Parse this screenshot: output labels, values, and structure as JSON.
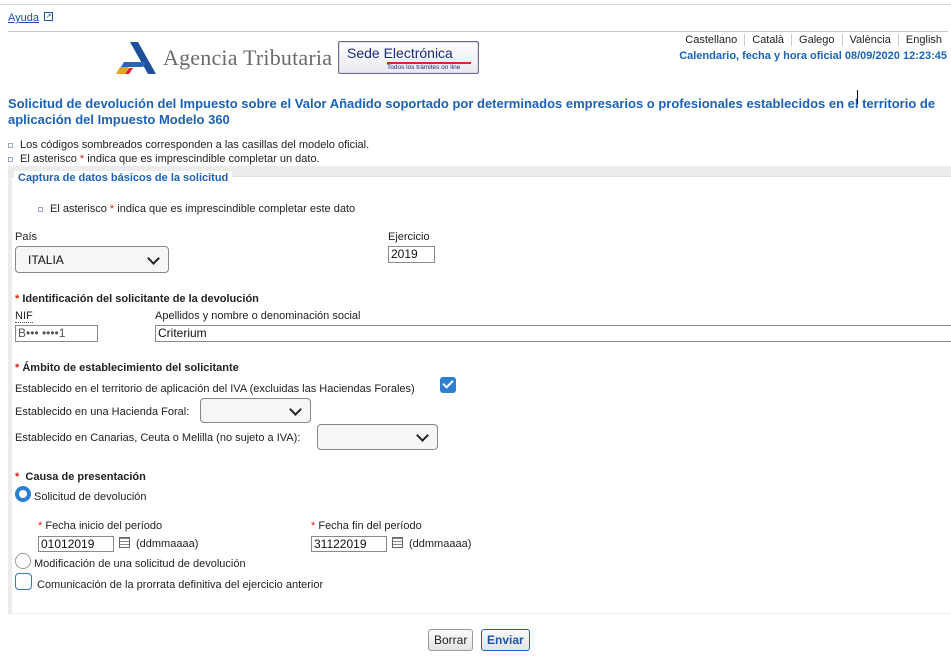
{
  "header": {
    "help_link": "Ayuda",
    "logo_text": "Agencia Tributaria",
    "sede_main": "Sede Electrónica",
    "sede_sub": "Todos los trámites on line",
    "languages": [
      "Castellano",
      "Català",
      "Galego",
      "València",
      "English"
    ],
    "calendar": "Calendario, fecha y hora oficial 08/09/2020 12:23:45"
  },
  "page": {
    "title": "Solicitud de devolución del Impuesto sobre el Valor Añadido soportado por determinados empresarios o profesionales establecidos en el territorio de aplicación del Impuesto Modelo 360",
    "note1": "Los códigos sombreados corresponden a las casillas del modelo oficial.",
    "note2_pre": "El asterisco ",
    "note2_star": "*",
    "note2_post": " indica que es imprescindible completar un dato."
  },
  "form": {
    "legend": "Captura de datos básicos de la solicitud",
    "asterisk_note_pre": "El asterisco ",
    "asterisk_note_star": "*",
    "asterisk_note_post": " indica que es imprescindible completar este dato",
    "pais_label": "País",
    "pais_value": "ITALIA",
    "ejercicio_label": "Ejercicio",
    "ejercicio_value": "2019",
    "ident_title": "Identificación del solicitante de la devolución",
    "nif_label": "NIF",
    "nif_value": "B••• ••••1",
    "nombre_label": "Apellidos y nombre o denominación social",
    "nombre_value": "Criterium",
    "ambito_title": "Ámbito de establecimiento del solicitante",
    "ambito_iva": "Establecido en el territorio de aplicación del IVA (excluidas las Haciendas Forales)",
    "ambito_foral": "Establecido en una Hacienda Foral:",
    "ambito_canarias": "Establecido en Canarias, Ceuta o Melilla (no sujeto a IVA):",
    "causa_title": "Causa de presentación",
    "opt_solicitud": "Solicitud de devolución",
    "fecha_inicio_label": "Fecha inicio del período",
    "fecha_inicio_value": "01012019",
    "fecha_fin_label": "Fecha fin del período",
    "fecha_fin_value": "31122019",
    "date_format": "(ddmmaaaa)",
    "opt_modificacion": "Modificación de una solicitud de devolución",
    "opt_prorrata": "Comunicación de la prorrata definitiva del ejercicio anterior",
    "star": "*"
  },
  "buttons": {
    "borrar": "Borrar",
    "enviar": "Enviar"
  },
  "colors": {
    "accent": "#1a63b8",
    "required": "#d21111",
    "panel_bg": "#ececec"
  }
}
